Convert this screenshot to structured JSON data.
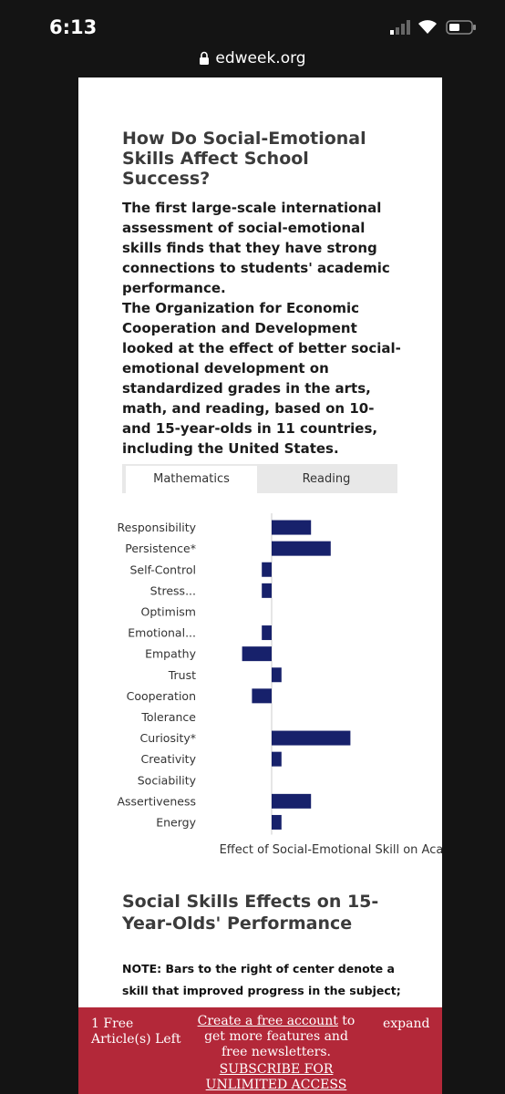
{
  "status_bar": {
    "time": "6:13"
  },
  "browser": {
    "url": "edweek.org"
  },
  "article": {
    "title": "How Do Social-Emotional Skills Affect School Success?",
    "intro_1": "The first large-scale international assessment of social-emotional skills finds that they have strong connections to students' academic performance.",
    "intro_2": "The Organization for Economic Cooperation and Development looked at the effect of better social-emotional development on standardized grades in the arts, math, and reading, based on 10- and 15-year-olds in 11 countries, including the United States.",
    "tabs": [
      {
        "label": "Mathematics",
        "active": true
      },
      {
        "label": "Reading",
        "active": false
      }
    ],
    "section_title": "Social Skills Effects on 15-Year-Olds' Performance",
    "note": "NOTE: Bars to the right of center denote a skill that improved progress in the subject; bars to"
  },
  "chart_data": {
    "type": "bar",
    "orientation": "horizontal",
    "categories": [
      "Responsibility",
      "Persistence*",
      "Self-Control",
      "Stress...",
      "Optimism",
      "Emotional...",
      "Empathy",
      "Trust",
      "Cooperation",
      "Tolerance",
      "Curiosity*",
      "Creativity",
      "Sociability",
      "Assertiveness",
      "Energy"
    ],
    "values": [
      4,
      6,
      -1,
      -1,
      0,
      -1,
      -3,
      1,
      -2,
      0,
      8,
      1,
      0,
      4,
      1
    ],
    "xlabel": "Effect of Social-Emotional Skill on Academic",
    "bar_color": "#17216b",
    "axis_color": "#cccccc"
  },
  "banner": {
    "left_text": "1 Free Article(s) Left",
    "link_text": "Create a free account",
    "mid_text": "to get more features and free newsletters.",
    "subscribe_text": "SUBSCRIBE FOR UNLIMITED ACCESS",
    "expand_text": "expand",
    "bg_color": "#b32839"
  }
}
